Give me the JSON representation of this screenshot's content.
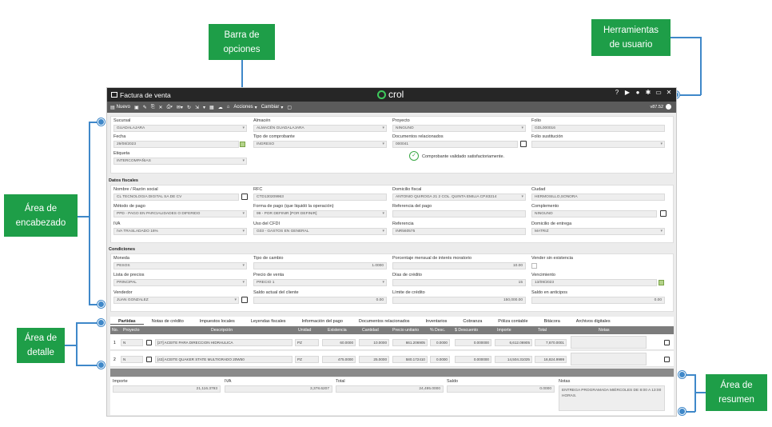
{
  "callouts": {
    "barra": "Barra de\nopciones",
    "herramientas": "Herramientas\nde usuario",
    "encabezado": "Área de\nencabezado",
    "detalle": "Área de\ndetalle",
    "resumen": "Área de\nresumen"
  },
  "titlebar": {
    "title": "Factura de venta",
    "brand": "crol"
  },
  "toolbar": {
    "nuevo": "Nuevo",
    "acciones": "Acciones",
    "cambiar": "Cambiar",
    "version": "v87.52"
  },
  "header": {
    "sucursal": {
      "label": "Sucursal",
      "value": "GUADALAJARA"
    },
    "almacen": {
      "label": "Almacén",
      "value": "ALMACÉN GUADALAJARA"
    },
    "proyecto": {
      "label": "Proyecto",
      "value": "NINGUNO"
    },
    "folio": {
      "label": "Folio",
      "value": "GDL000016"
    },
    "fecha": {
      "label": "Fecha",
      "value": "29/08/2023"
    },
    "tipo_comprobante": {
      "label": "Tipo de comprobante",
      "value": "INGRESO"
    },
    "documentos": {
      "label": "Documentos relacionados",
      "value": "000041"
    },
    "folio_sustitucion": {
      "label": "Folio sustitución",
      "value": ""
    },
    "etiqueta": {
      "label": "Etiqueta",
      "value": "INTERCOMPAÑIAS"
    },
    "validado": "Comprobante validado satisfactoriamente."
  },
  "fiscales": {
    "title": "Datos fiscales",
    "nombre": {
      "label": "Nombre / Razón social",
      "value": "CL TECNOLOGIA DIGITAL SA DE CV"
    },
    "rfc": {
      "label": "RFC",
      "value": "CTD130209963"
    },
    "domicilio_fiscal": {
      "label": "Domicilio fiscal",
      "value": "ANTONIO QUIROGA 21 2 COL. QUINTA EMILIA CP.83214"
    },
    "ciudad": {
      "label": "Ciudad",
      "value": "HERMOSILLO,SONORA"
    },
    "metodo_pago": {
      "label": "Método de pago",
      "value": "PPD - PAGO EN PARCIALIDADES O DIFERIDO"
    },
    "forma_pago": {
      "label": "Forma de pago (que liquidó la operación)",
      "value": "99 - POR DEFINIR [POR DEFINIR]"
    },
    "referencia_pago": {
      "label": "Referencia del pago",
      "value": ""
    },
    "complemento": {
      "label": "Complemento",
      "value": "NINGUNO"
    },
    "iva": {
      "label": "IVA",
      "value": "IVA TRASLADADO 16%"
    },
    "uso_cfdi": {
      "label": "Uso del CFDI",
      "value": "G03 - GASTOS EN GENERAL"
    },
    "referencia": {
      "label": "Referencia",
      "value": "INR560575"
    },
    "domicilio_entrega": {
      "label": "Domicilio de entrega",
      "value": "MATRIZ"
    }
  },
  "condiciones": {
    "title": "Condiciones",
    "moneda": {
      "label": "Moneda",
      "value": "PESOS"
    },
    "tipo_cambio": {
      "label": "Tipo de cambio",
      "value": "1.0000"
    },
    "porcentaje": {
      "label": "Porcentaje mensual de interés moratorio",
      "value": "10.00"
    },
    "vender": {
      "label": "Vender sin existencia"
    },
    "lista": {
      "label": "Lista de precios",
      "value": "PRINCIPAL"
    },
    "precio_venta": {
      "label": "Precio de venta",
      "value": "PRECIO 1"
    },
    "dias": {
      "label": "Días de crédito",
      "value": "15"
    },
    "vencimiento": {
      "label": "Vencimiento",
      "value": "13/09/2023"
    },
    "vendedor": {
      "label": "Vendedor",
      "value": "JUAN GONZALEZ"
    },
    "saldo_actual": {
      "label": "Saldo actual del cliente",
      "value": "0.00"
    },
    "limite": {
      "label": "Límite de crédito",
      "value": "150,000.00"
    },
    "saldo_anticipos": {
      "label": "Saldo en anticipos",
      "value": "0.00"
    }
  },
  "tabs": [
    "Partidas",
    "Notas de crédito",
    "Impuestos locales",
    "Leyendas fiscales",
    "Información del pago",
    "Documentos relacionados",
    "Inventarios",
    "Cobranza",
    "Póliza contable",
    "Bitácora",
    "Archivos digitales"
  ],
  "grid": {
    "headers": [
      "No.",
      "Proyecto",
      "Descripción",
      "Unidad",
      "Existencia",
      "Cantidad",
      "Precio unitario",
      "% Desc.",
      "$ Descuento",
      "Importe",
      "Total",
      "Notas"
    ],
    "rows": [
      {
        "no": "1",
        "proyecto": "N",
        "descripcion": "[27] ACEITE PARA DIRECCION HIDRAULICA",
        "unidad": "PZ",
        "existencia": "60.0000",
        "cantidad": "10.0000",
        "precio": "661.206905",
        "desc": "0.0000",
        "descuento": "0.000000",
        "importe": "6,612.06905",
        "total": "7,670.0001"
      },
      {
        "no": "2",
        "proyecto": "N",
        "descripcion": "[43] ACEITE QUAKER STATE MULTIGRADO 20W50",
        "unidad": "PZ",
        "existencia": "475.0000",
        "cantidad": "25.0000",
        "precio": "580.172410",
        "desc": "0.0000",
        "descuento": "0.000000",
        "importe": "14,504.31025",
        "total": "16,824.9999"
      }
    ]
  },
  "resumen": {
    "importe": {
      "label": "Importe",
      "value": "21,116.3793"
    },
    "iva": {
      "label": "IVA",
      "value": "3,378.6207"
    },
    "total": {
      "label": "Total",
      "value": "24,495.0000"
    },
    "saldo": {
      "label": "Saldo",
      "value": "0.0000"
    },
    "notas": {
      "label": "Notas",
      "value": "ENTREGA PROGRAMADA MIÉRCOLES DE 8:00 A 13:00 HORAS."
    }
  }
}
